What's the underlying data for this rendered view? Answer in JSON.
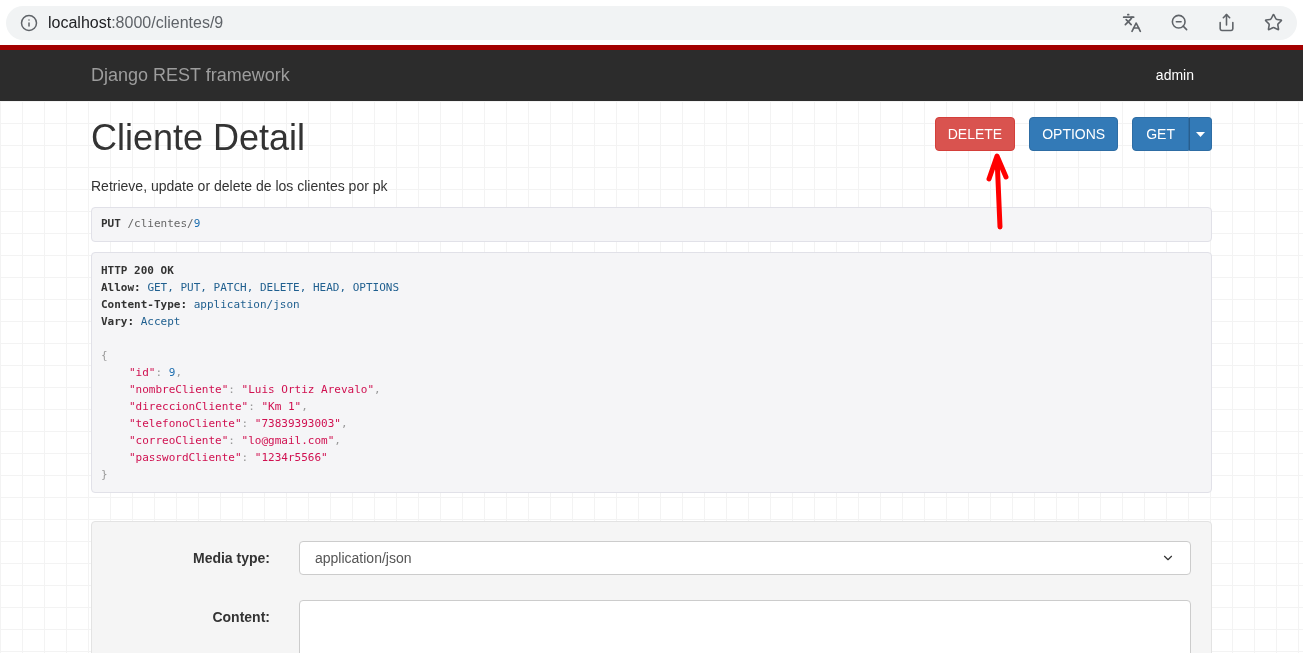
{
  "browser": {
    "host": "localhost",
    "path": ":8000/clientes/9"
  },
  "navbar": {
    "brand": "Django REST framework",
    "user": "admin"
  },
  "page": {
    "title": "Cliente Detail",
    "description": "Retrieve, update or delete de los clientes por pk"
  },
  "actions": [
    {
      "label": "DELETE",
      "kind": "danger"
    },
    {
      "label": "OPTIONS",
      "kind": "primary"
    },
    {
      "label": "GET",
      "kind": "split"
    }
  ],
  "request": {
    "method": "PUT",
    "path": "/clientes/",
    "id": "9"
  },
  "response": {
    "status": "HTTP 200 OK",
    "headers": [
      {
        "key": "Allow:",
        "value": "GET, PUT, PATCH, DELETE, HEAD, OPTIONS"
      },
      {
        "key": "Content-Type:",
        "value": "application/json"
      },
      {
        "key": "Vary:",
        "value": "Accept"
      }
    ],
    "open": "{",
    "close": "}",
    "colon": ":",
    "fields": [
      {
        "key": "\"id\"",
        "value": "9",
        "kind": "number",
        "comma": ","
      },
      {
        "key": "\"nombreCliente\"",
        "value": "\"Luis Ortiz Arevalo\"",
        "kind": "string",
        "comma": ","
      },
      {
        "key": "\"direccionCliente\"",
        "value": "\"Km 1\"",
        "kind": "string",
        "comma": ","
      },
      {
        "key": "\"telefonoCliente\"",
        "value": "\"73839393003\"",
        "kind": "string",
        "comma": ","
      },
      {
        "key": "\"correoCliente\"",
        "value": "\"lo@gmail.com\"",
        "kind": "string",
        "comma": ","
      },
      {
        "key": "\"passwordCliente\"",
        "value": "\"1234r5566\"",
        "kind": "string"
      }
    ]
  },
  "form": {
    "media_type": {
      "label": "Media type:",
      "value": "application/json"
    },
    "content": {
      "label": "Content:"
    }
  }
}
